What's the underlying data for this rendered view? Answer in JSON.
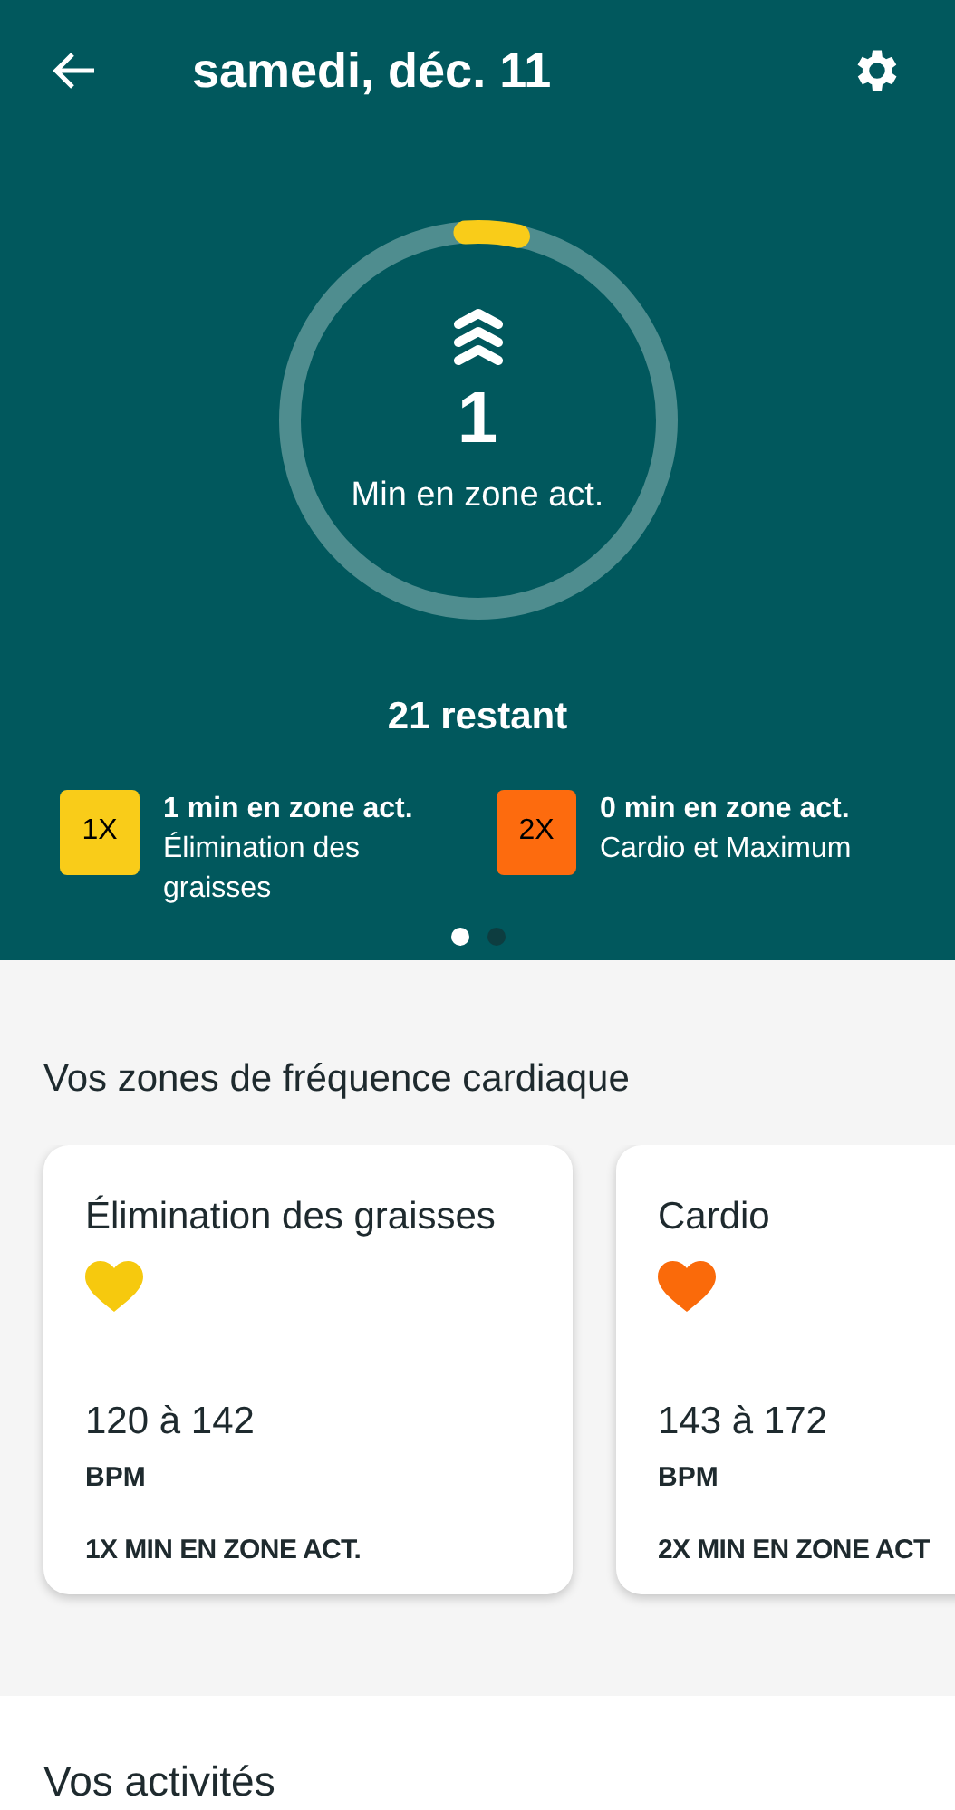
{
  "header": {
    "title": "samedi, déc. 11"
  },
  "ring": {
    "value": "1",
    "label": "Min en zone act.",
    "remaining": "21 restant"
  },
  "zones_summary": [
    {
      "badge": "1X",
      "color": "#f9cc19",
      "minutes": "1 min en zone act.",
      "zone": "Élimination des graisses"
    },
    {
      "badge": "2X",
      "color": "#fd6b0e",
      "minutes": "0 min en zone act.",
      "zone": "Cardio et Maximum"
    }
  ],
  "pager": [
    {
      "selected": true
    },
    {
      "selected": false
    }
  ],
  "heart_zones": {
    "title": "Vos zones de fréquence cardiaque",
    "cards": [
      {
        "name": "Élimination des graisses",
        "color": "#f6c90e",
        "range": "120 à 142",
        "unit": "BPM",
        "multiplier": "1X MIN EN ZONE ACT."
      },
      {
        "name": "Cardio",
        "color": "#fa6a0a",
        "range": "143 à 172",
        "unit": "BPM",
        "multiplier": "2X MIN EN ZONE ACT"
      }
    ]
  },
  "activities": {
    "title": "Vos activités"
  }
}
